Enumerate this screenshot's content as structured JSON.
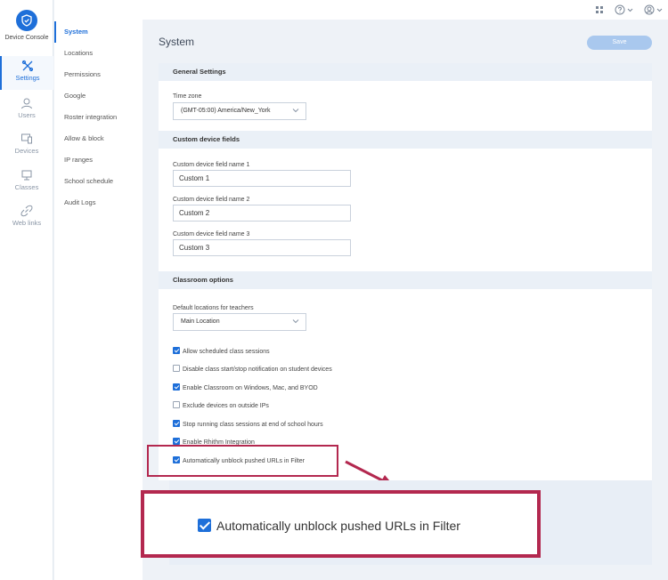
{
  "app": {
    "name": "Device Console"
  },
  "rail": [
    {
      "label": "Settings",
      "icon": "settings-icon",
      "active": true
    },
    {
      "label": "Users",
      "icon": "user-icon"
    },
    {
      "label": "Devices",
      "icon": "devices-icon"
    },
    {
      "label": "Classes",
      "icon": "classes-icon"
    },
    {
      "label": "Web links",
      "icon": "link-icon"
    }
  ],
  "subnav": [
    "System",
    "Locations",
    "Permissions",
    "Google",
    "Roster integration",
    "Allow & block",
    "IP ranges",
    "School schedule",
    "Audit Logs"
  ],
  "page": {
    "title": "System",
    "save_label": "Save"
  },
  "general": {
    "heading": "General Settings",
    "timezone_label": "Time zone",
    "timezone_value": "(GMT-05:00) America/New_York"
  },
  "custom": {
    "heading": "Custom device fields",
    "fields": [
      {
        "label": "Custom device field name 1",
        "value": "Custom 1"
      },
      {
        "label": "Custom device field name 2",
        "value": "Custom 2"
      },
      {
        "label": "Custom device field name 3",
        "value": "Custom 3"
      }
    ]
  },
  "classroom": {
    "heading": "Classroom options",
    "default_location_label": "Default locations for teachers",
    "default_location_value": "Main Location",
    "options": [
      {
        "label": "Allow scheduled class sessions",
        "checked": true
      },
      {
        "label": "Disable class start/stop notification on student devices",
        "checked": false
      },
      {
        "label": "Enable Classroom on Windows, Mac, and BYOD",
        "checked": true
      },
      {
        "label": "Exclude devices on outside IPs",
        "checked": false
      },
      {
        "label": "Stop running class sessions at end of school hours",
        "checked": true
      },
      {
        "label": "Enable Rhithm Integration",
        "checked": true
      },
      {
        "label": "Automatically unblock pushed URLs in Filter",
        "checked": true
      }
    ]
  },
  "zoom": {
    "label": "Automatically unblock pushed URLs in Filter"
  },
  "colors": {
    "accent": "#1e6fd9",
    "highlight": "#b3284f"
  }
}
